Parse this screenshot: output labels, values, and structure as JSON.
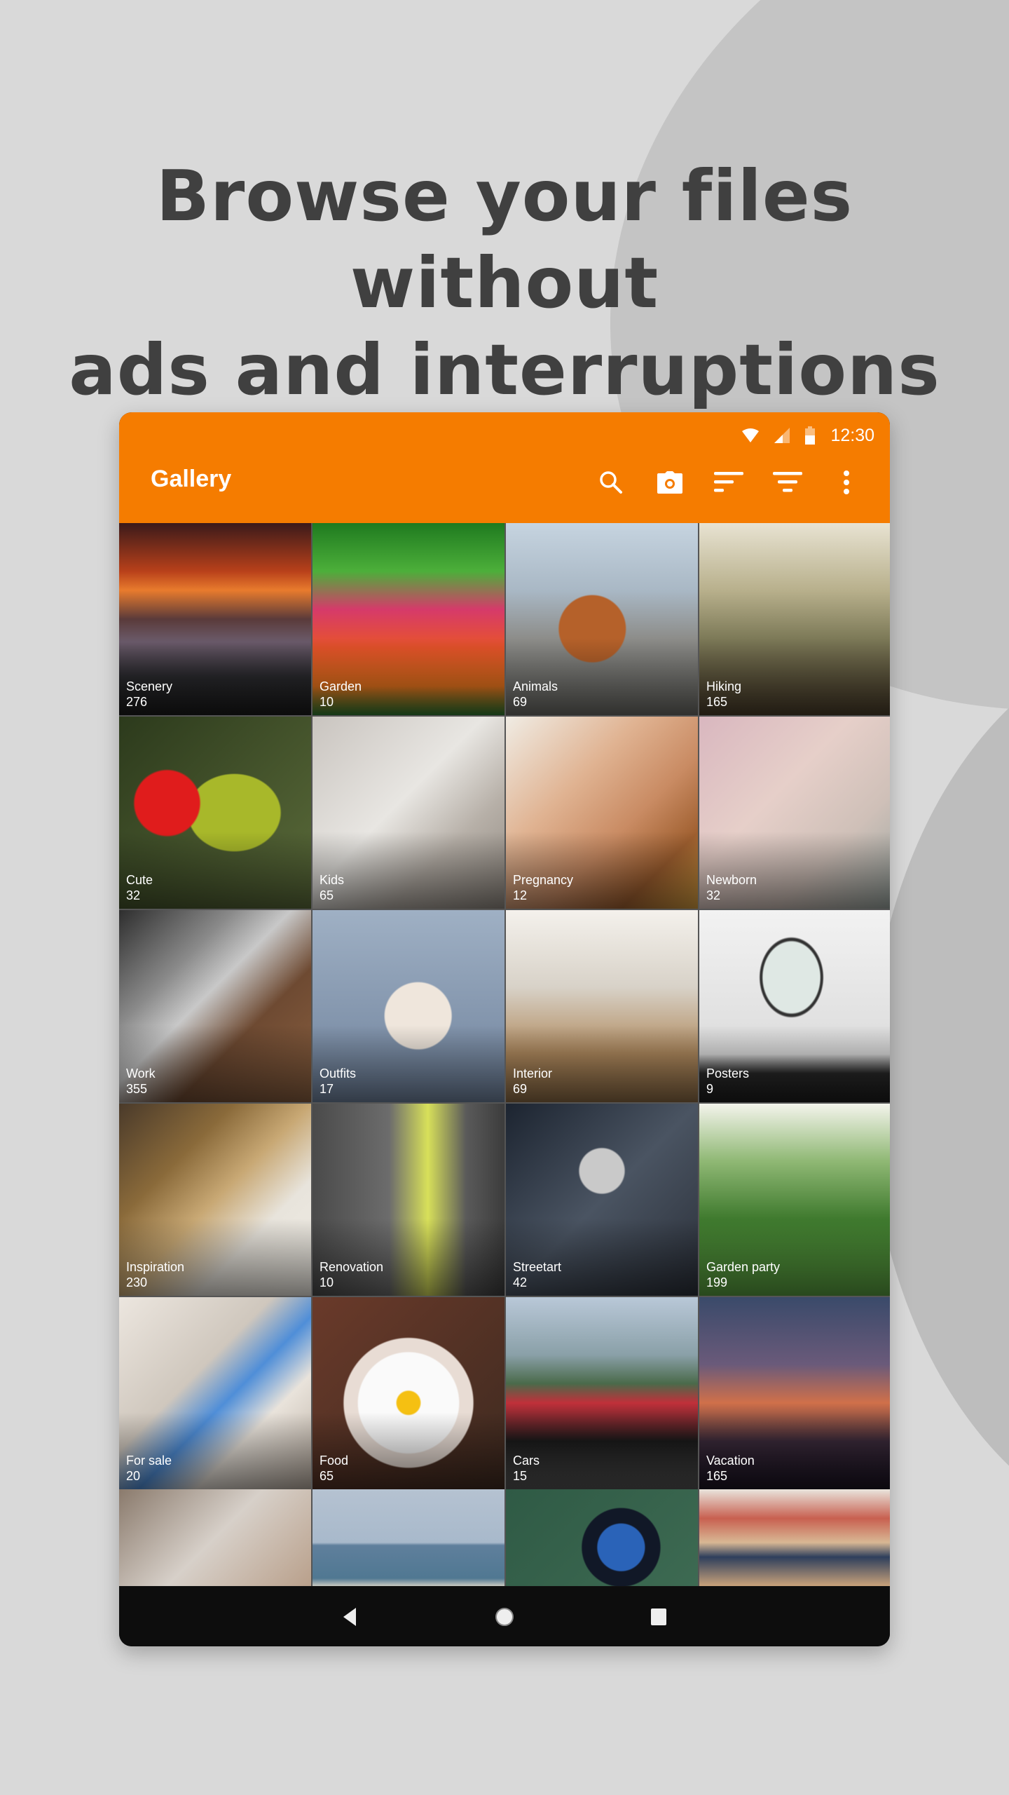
{
  "headline": {
    "line1": "Browse your files without",
    "line2": "ads and interruptions"
  },
  "status_bar": {
    "time": "12:30",
    "icons": [
      "wifi-icon",
      "cellular-signal-icon",
      "battery-icon"
    ]
  },
  "app_bar": {
    "title": "Gallery",
    "actions": [
      {
        "name": "search",
        "icon": "search-icon"
      },
      {
        "name": "camera",
        "icon": "camera-icon"
      },
      {
        "name": "sort",
        "icon": "sort-icon"
      },
      {
        "name": "filter",
        "icon": "filter-icon"
      },
      {
        "name": "more",
        "icon": "more-vert-icon"
      }
    ],
    "accent_color": "#f57c00"
  },
  "folders": [
    {
      "label": "Scenery",
      "count": "276"
    },
    {
      "label": "Garden",
      "count": "10"
    },
    {
      "label": "Animals",
      "count": "69"
    },
    {
      "label": "Hiking",
      "count": "165"
    },
    {
      "label": "Cute",
      "count": "32"
    },
    {
      "label": "Kids",
      "count": "65"
    },
    {
      "label": "Pregnancy",
      "count": "12"
    },
    {
      "label": "Newborn",
      "count": "32"
    },
    {
      "label": "Work",
      "count": "355"
    },
    {
      "label": "Outfits",
      "count": "17"
    },
    {
      "label": "Interior",
      "count": "69"
    },
    {
      "label": "Posters",
      "count": "9"
    },
    {
      "label": "Inspiration",
      "count": "230"
    },
    {
      "label": "Renovation",
      "count": "10"
    },
    {
      "label": "Streetart",
      "count": "42"
    },
    {
      "label": "Garden party",
      "count": "199"
    },
    {
      "label": "For sale",
      "count": "20"
    },
    {
      "label": "Food",
      "count": "65"
    },
    {
      "label": "Cars",
      "count": "15"
    },
    {
      "label": "Vacation",
      "count": "165"
    }
  ],
  "nav_bar": {
    "buttons": [
      "back-icon",
      "home-icon",
      "recents-icon"
    ]
  }
}
